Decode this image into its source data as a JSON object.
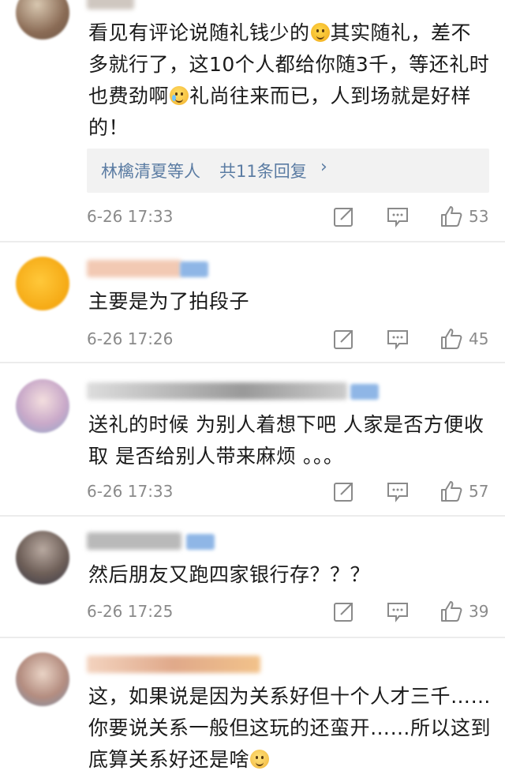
{
  "comments": [
    {
      "text_parts": [
        "看见有评论说随礼钱少的",
        "其实随礼，差不多就行了，这10个人都给你随3千，等还礼时也费劲啊",
        "礼尚往来而已，人到场就是好样的！"
      ],
      "emojis": [
        "grin-emoji",
        "cry-emoji"
      ],
      "replies": {
        "names": "林檎清夏等人",
        "count": "共11条回复"
      },
      "timestamp": "6-26 17:33",
      "likes": "53"
    },
    {
      "text": "主要是为了拍段子",
      "timestamp": "6-26 17:26",
      "likes": "45"
    },
    {
      "text": "送礼的时候 为别人着想下吧 人家是否方便收取 是否给别人带来麻烦 。。。",
      "timestamp": "6-26 17:33",
      "likes": "57"
    },
    {
      "text": "然后朋友又跑四家银行存？？？",
      "timestamp": "6-26 17:25",
      "likes": "39"
    },
    {
      "text_parts": [
        "这，如果说是因为关系好但十个人才三千……你要说关系一般但这玩的还蛮开……所以这到底算关系好还是啥"
      ],
      "emojis": [
        "shy-emoji"
      ]
    }
  ],
  "icons": {
    "repost": "repost-icon",
    "comment": "comment-icon",
    "like": "like-icon"
  },
  "colors": {
    "link": "#5b7ca3",
    "meta": "#8a8a8a",
    "reply_bg": "#f2f2f2"
  }
}
